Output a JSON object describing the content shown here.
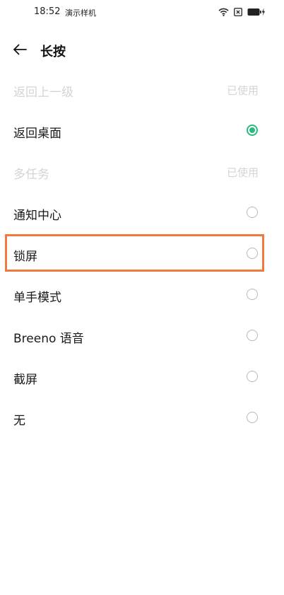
{
  "status_bar": {
    "time": "18:52",
    "carrier": "演示样机",
    "icons": [
      "wifi-icon",
      "sim-icon",
      "battery-charging-icon"
    ]
  },
  "header": {
    "back_icon": "arrow-left-icon",
    "title": "长按"
  },
  "options": [
    {
      "label": "返回上一级",
      "status": "已使用",
      "disabled": true,
      "checked": false
    },
    {
      "label": "返回桌面",
      "status": "",
      "disabled": false,
      "checked": true
    },
    {
      "label": "多任务",
      "status": "已使用",
      "disabled": true,
      "checked": false
    },
    {
      "label": "通知中心",
      "status": "",
      "disabled": false,
      "checked": false
    },
    {
      "label": "锁屏",
      "status": "",
      "disabled": false,
      "checked": false
    },
    {
      "label": "单手模式",
      "status": "",
      "disabled": false,
      "checked": false
    },
    {
      "label": "Breeno 语音",
      "status": "",
      "disabled": false,
      "checked": false
    },
    {
      "label": "截屏",
      "status": "",
      "disabled": false,
      "checked": false
    },
    {
      "label": "无",
      "status": "",
      "disabled": false,
      "checked": false
    }
  ],
  "colors": {
    "accent": "#2db881",
    "highlight": "#f07a3e",
    "disabled_text": "#d4d4d4"
  }
}
